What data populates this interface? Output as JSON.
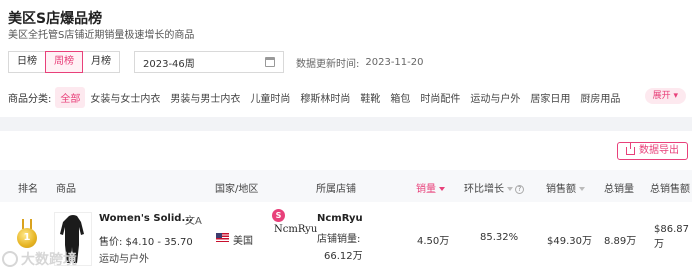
{
  "header": {
    "title": "美区S店爆品榜",
    "subtitle": "美区全托管S店铺近期销量极速增长的商品"
  },
  "period_tabs": [
    "日榜",
    "周榜",
    "月榜"
  ],
  "date_picker": {
    "value": "2023-46周",
    "icon": "calendar-icon"
  },
  "update": {
    "label": "数据更新时间:",
    "value": "2023-11-20"
  },
  "categories": {
    "label": "商品分类:",
    "items": [
      "全部",
      "女装与女士内衣",
      "男装与男士内衣",
      "儿童时尚",
      "穆斯林时尚",
      "鞋靴",
      "箱包",
      "时尚配件",
      "运动与户外",
      "居家日用",
      "厨房用品"
    ],
    "expand_label": "展开"
  },
  "toolbar": {
    "export_label": "数据导出"
  },
  "table": {
    "headers": {
      "rank": "排名",
      "product": "商品",
      "region": "国家/地区",
      "shop": "所属店铺",
      "sales": "销量",
      "growth": "环比增长",
      "revenue": "销售额",
      "total_sales": "总销量",
      "total_revenue": "总销售额"
    },
    "rows": [
      {
        "rank": "1",
        "product_name": "Women's Solid...",
        "price": "售价: $4.10 - 35.70",
        "category": "运动与户外",
        "country": "美国",
        "shop_logo_letter": "S",
        "shop_logo_text": "NcmRyu",
        "shop_name": "NcmRyu",
        "shop_sales_label": "店铺销量:",
        "shop_sales_value": "66.12万",
        "sales": "4.50万",
        "growth": "85.32%",
        "revenue": "$49.30万",
        "total_sales": "8.89万",
        "total_revenue_line1": "$86.87",
        "total_revenue_line2": "万"
      }
    ]
  },
  "watermark": "大数跨境",
  "colors": {
    "accent": "#e8407a",
    "accent_bg": "#fde9ef",
    "header_bg": "#f7f8fa"
  }
}
